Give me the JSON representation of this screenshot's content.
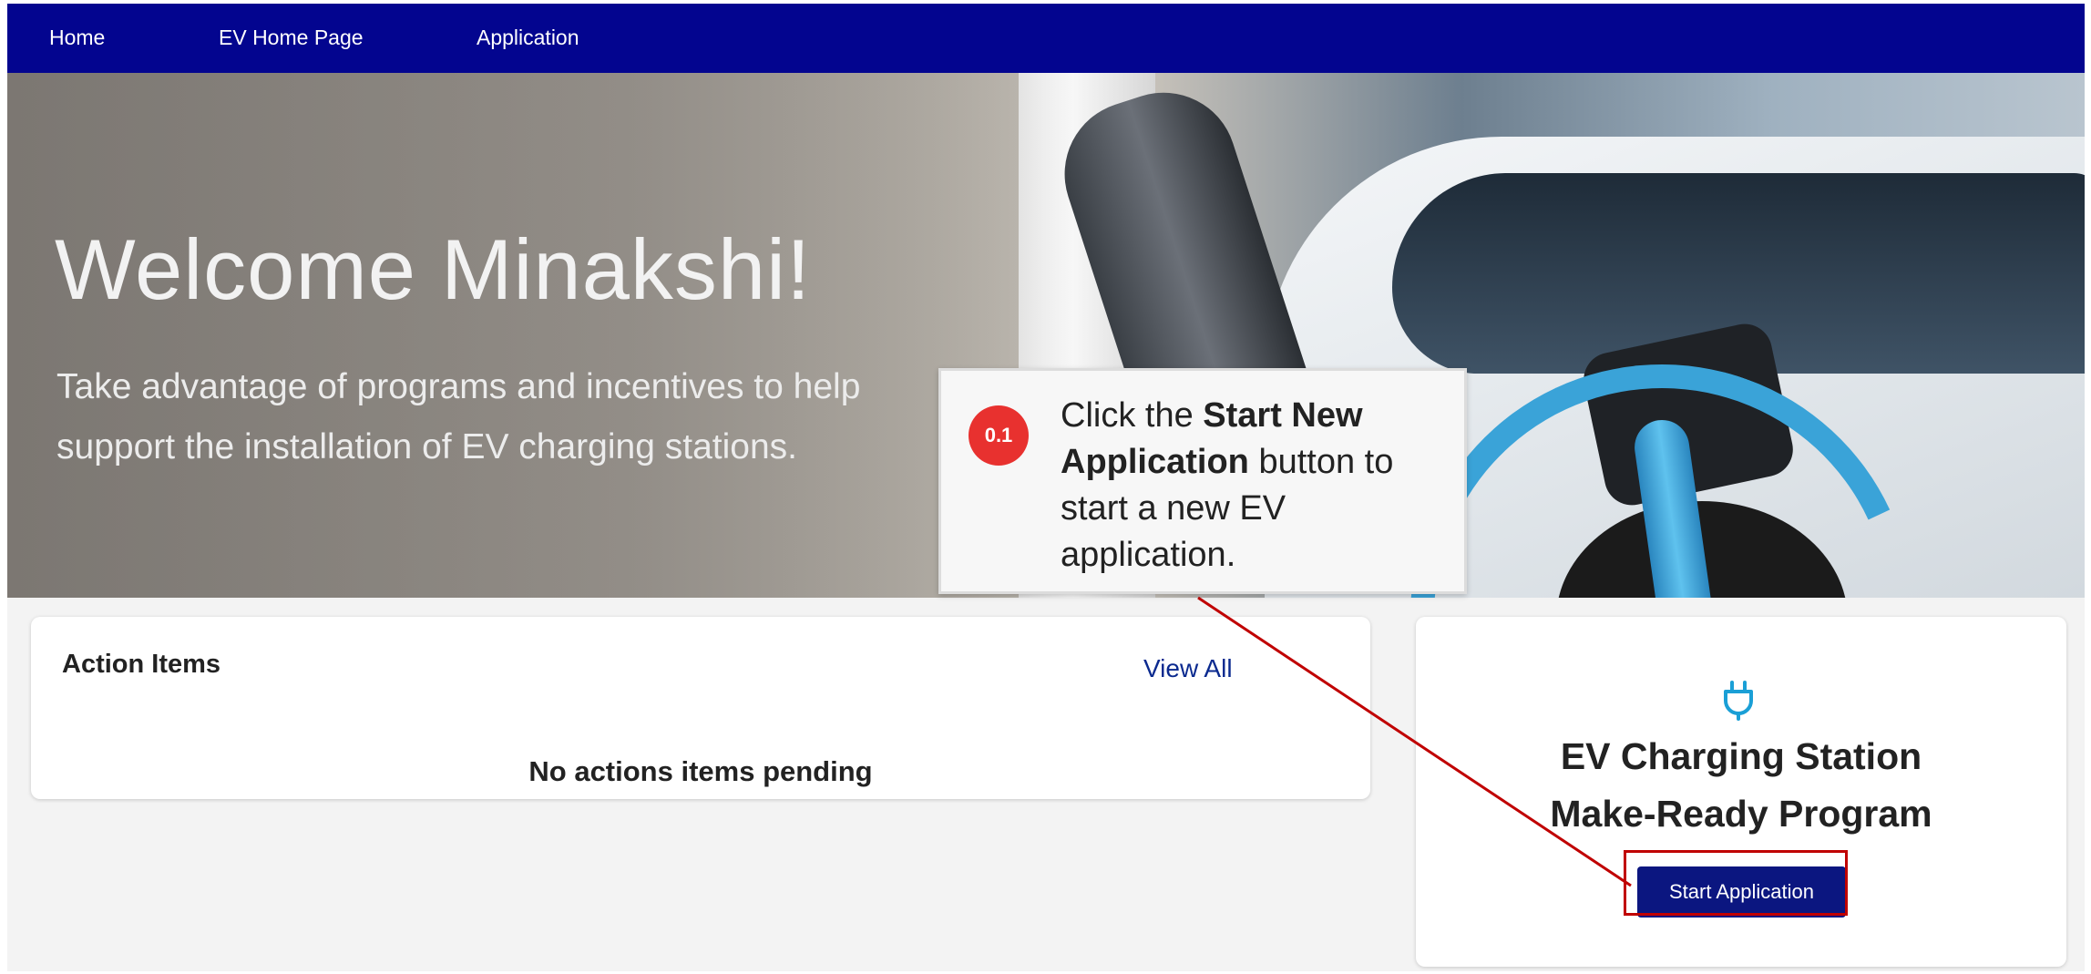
{
  "nav": {
    "items": [
      {
        "label": "Home"
      },
      {
        "label": "EV Home Page"
      },
      {
        "label": "Application"
      }
    ]
  },
  "hero": {
    "title": "Welcome Minakshi!",
    "subtitle": "Take advantage of programs and incentives to help support the installation of EV charging stations."
  },
  "action_items": {
    "title": "Action Items",
    "view_all": "View All",
    "empty_message": "No actions items pending"
  },
  "program_card": {
    "icon": "plug-icon",
    "title_line1": "EV Charging Station",
    "title_line2": "Make-Ready Program",
    "button_label": "Start Application"
  },
  "callout": {
    "step": "0.1",
    "text_before": "Click the ",
    "text_bold": "Start New Application",
    "text_after": " button to start a new EV application."
  },
  "colors": {
    "nav_bg": "#03058f",
    "button_bg": "#0b1680",
    "highlight": "#c00000",
    "badge": "#e8312f",
    "icon": "#1a9fd6"
  }
}
